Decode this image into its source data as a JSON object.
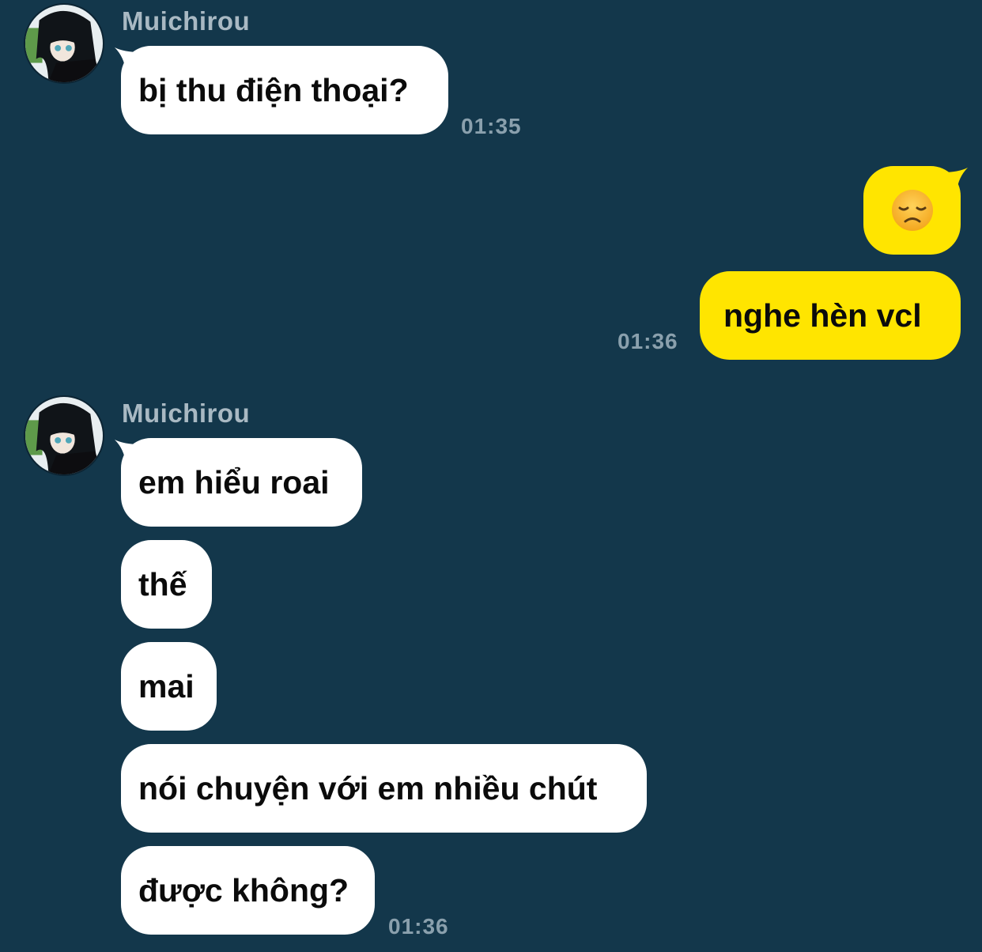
{
  "colors": {
    "background": "#13374b",
    "incoming_bubble": "#ffffff",
    "outgoing_bubble": "#ffe500",
    "timestamp": "#8aa0ad",
    "sender": "#a9b9c3"
  },
  "groups": [
    {
      "sender": "Muichirou",
      "messages": [
        {
          "text": "bị thu điện thoại?"
        }
      ],
      "time": "01:35"
    },
    {
      "outgoing": true,
      "messages": [
        {
          "icon": "disappointed-face-emoji"
        },
        {
          "text": "nghe hèn vcl"
        }
      ],
      "time": "01:36"
    },
    {
      "sender": "Muichirou",
      "messages": [
        {
          "text": "em hiểu roai"
        },
        {
          "text": "thế"
        },
        {
          "text": "mai"
        },
        {
          "text": "nói chuyện với em nhiều chút"
        },
        {
          "text": "được không?"
        }
      ],
      "time": "01:36"
    }
  ]
}
